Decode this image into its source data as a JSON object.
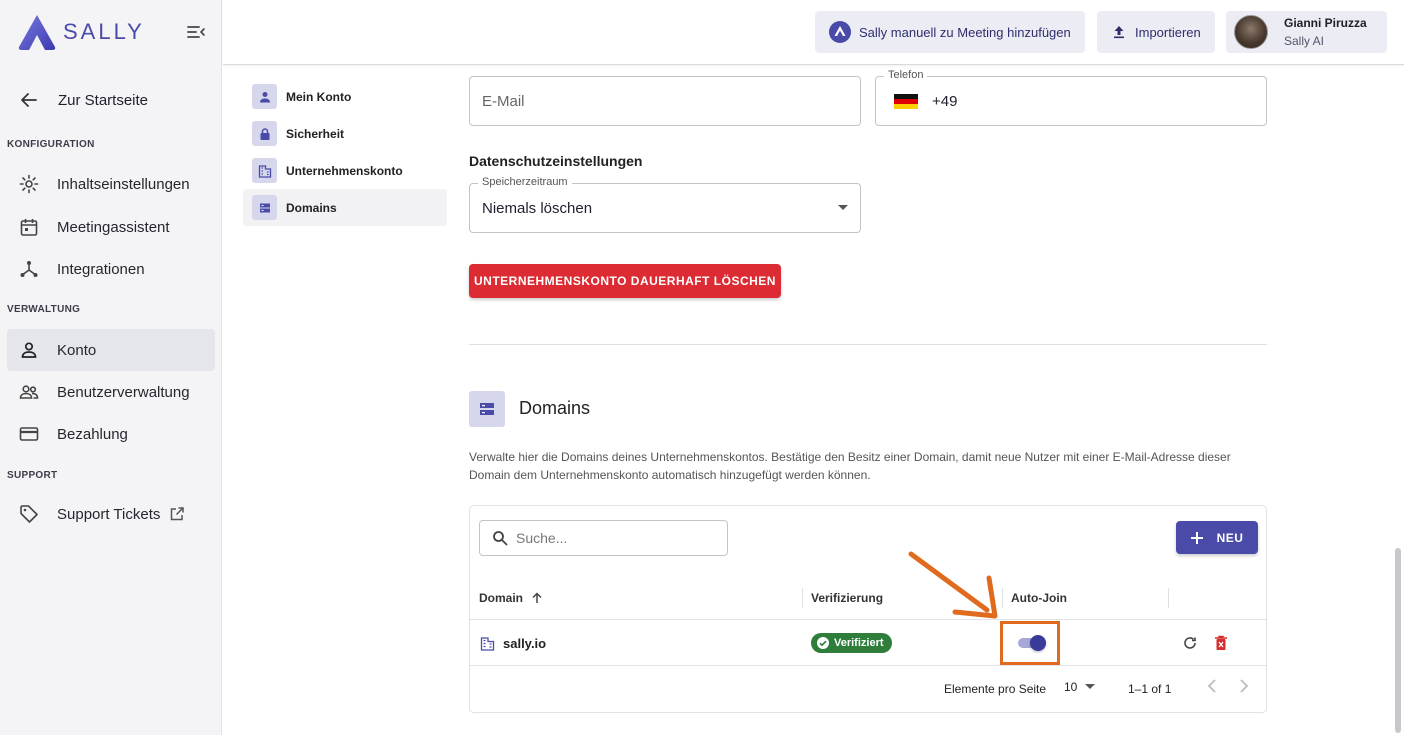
{
  "app": {
    "logo_text": "SALLY"
  },
  "sidebar": {
    "back_label": "Zur Startseite",
    "sections": {
      "konfiguration": "KONFIGURATION",
      "verwaltung": "VERWALTUNG",
      "support": "SUPPORT"
    },
    "items": {
      "inhalt": "Inhaltseinstellungen",
      "meeting": "Meetingassistent",
      "integrationen": "Integrationen",
      "konto": "Konto",
      "benutzer": "Benutzerverwaltung",
      "bezahlung": "Bezahlung",
      "support": "Support Tickets"
    }
  },
  "topbar": {
    "add_meeting": "Sally manuell zu Meeting hinzufügen",
    "import": "Importieren",
    "user_name": "Gianni Piruzza",
    "user_org": "Sally AI"
  },
  "subnav": {
    "mein_konto": "Mein Konto",
    "sicherheit": "Sicherheit",
    "unternehmen": "Unternehmenskonto",
    "domains": "Domains"
  },
  "form": {
    "email_placeholder": "E-Mail",
    "phone_label": "Telefon",
    "phone_value": "+49",
    "privacy_heading": "Datenschutzeinstellungen",
    "retention_label": "Speicherzeitraum",
    "retention_value": "Niemals löschen",
    "delete_button": "UNTERNEHMENSKONTO DAUERHAFT LÖSCHEN"
  },
  "domains": {
    "title": "Domains",
    "description": "Verwalte hier die Domains deines Unternehmenskontos. Bestätige den Besitz einer Domain, damit neue Nutzer mit einer E-Mail-Adresse dieser Domain dem Unternehmenskonto automatisch hinzugefügt werden können.",
    "search_placeholder": "Suche...",
    "new_button": "NEU",
    "columns": {
      "domain": "Domain",
      "verification": "Verifizierung",
      "autojoin": "Auto-Join"
    },
    "rows": [
      {
        "domain": "sally.io",
        "status": "Verifiziert",
        "autojoin": true
      }
    ],
    "footer": {
      "per_page_label": "Elemente pro Seite",
      "per_page": "10",
      "range": "1–1 of 1"
    }
  },
  "colors": {
    "accent": "#4a4aa8",
    "danger": "#dc2b32",
    "success": "#2e7d3a",
    "highlight": "#e06a1e"
  }
}
